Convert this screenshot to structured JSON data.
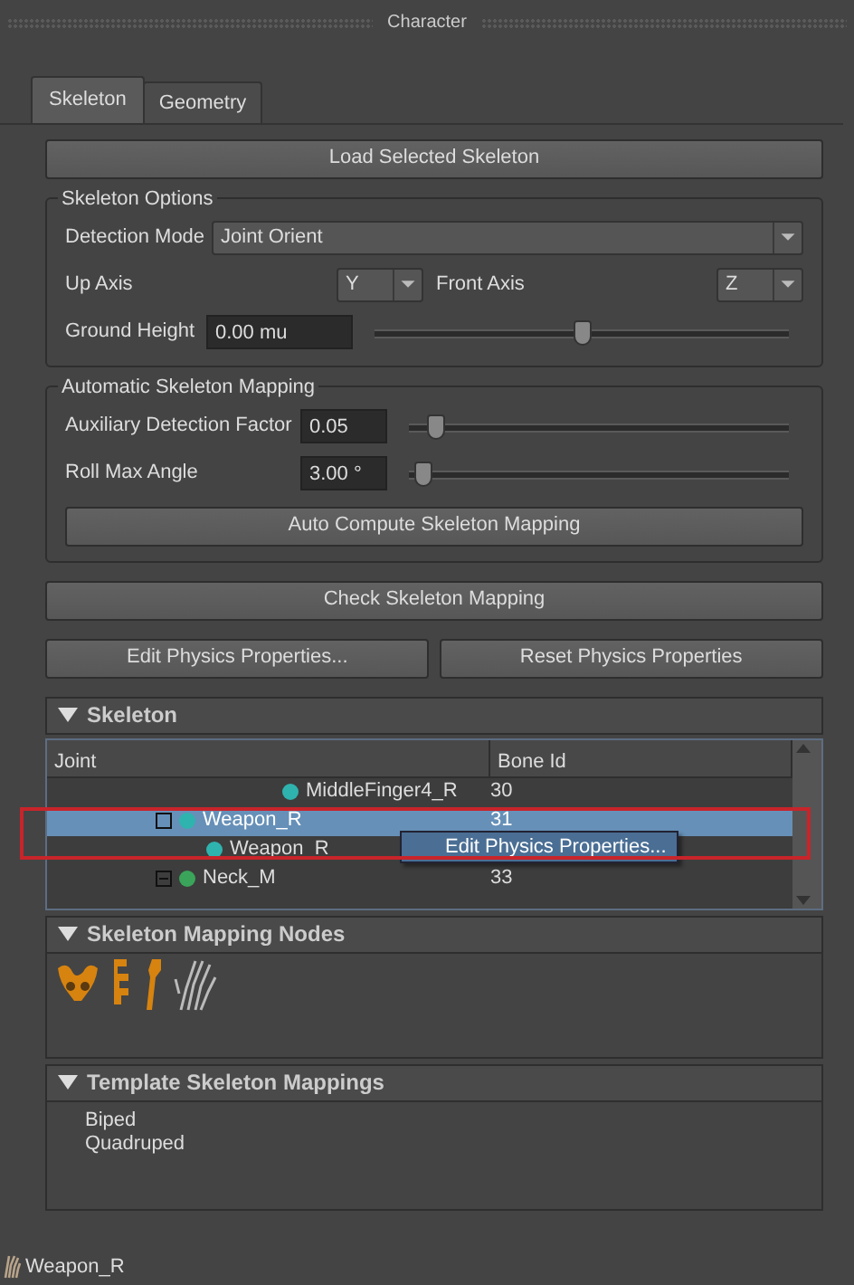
{
  "window": {
    "title": "Character"
  },
  "tabs": [
    {
      "label": "Skeleton",
      "selected": true
    },
    {
      "label": "Geometry",
      "selected": false
    }
  ],
  "load_button": "Load Selected Skeleton",
  "skeleton_options": {
    "title": "Skeleton Options",
    "detection_mode": {
      "label": "Detection Mode",
      "value": "Joint Orient"
    },
    "up_axis": {
      "label": "Up Axis",
      "value": "Y"
    },
    "front_axis": {
      "label": "Front Axis",
      "value": "Z"
    },
    "ground_height": {
      "label": "Ground Height",
      "value": "0.00 mu",
      "level": 0.5
    }
  },
  "automatic_mapping": {
    "title": "Automatic Skeleton Mapping",
    "fields": [
      {
        "label": "Auxiliary Detection Factor",
        "value": "0.05",
        "level": 0.07
      },
      {
        "label": "Roll Max Angle",
        "value": "3.00 °",
        "level": 0.04
      }
    ],
    "button": "Auto Compute Skeleton Mapping"
  },
  "check_button": "Check Skeleton Mapping",
  "physics_buttons": [
    "Edit Physics Properties...",
    "Reset Physics Properties"
  ],
  "skeleton_panel": {
    "title": "Skeleton",
    "expanded": true,
    "columns": [
      "Joint",
      "Bone Id"
    ],
    "rows": [
      {
        "joint": "MiddleFinger4_R",
        "bone_id": "30",
        "color": "#2fb3ae",
        "selected": false
      },
      {
        "joint": "Weapon_R",
        "bone_id": "31",
        "color": "#2fb3ae",
        "selected": true,
        "expanded": false,
        "children": [
          {
            "joint": "Weapon_R",
            "color": "#2fb3ae",
            "selected": false
          }
        ]
      },
      {
        "joint": "Neck_M",
        "bone_id": "33",
        "color": "#3aa55a",
        "selected": false,
        "expanded": true
      }
    ],
    "context_menu": [
      "Edit Physics Properties..."
    ]
  },
  "mapping_nodes_panel": {
    "title": "Skeleton Mapping Nodes",
    "expanded": true,
    "nodes": [
      {
        "kind": "pelvis"
      },
      {
        "kind": "spine"
      },
      {
        "kind": "arm"
      },
      {
        "kind": "hand"
      }
    ]
  },
  "template_panel": {
    "title": "Template Skeleton Mappings",
    "expanded": true,
    "items": [
      "Biped",
      "Quadruped"
    ]
  },
  "status_bar": {
    "text": "Weapon_R"
  }
}
